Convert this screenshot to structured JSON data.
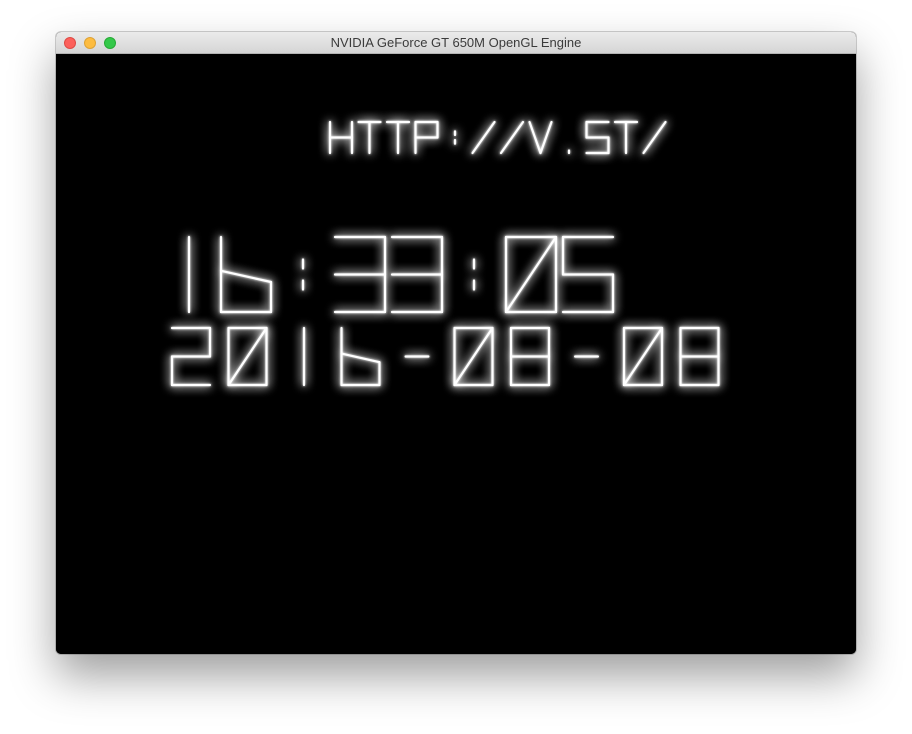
{
  "window": {
    "title": "NVIDIA GeForce GT 650M OpenGL Engine"
  },
  "display": {
    "url": "HTTP://V.ST/",
    "time": "16:33:05",
    "date": "2016-08-08"
  },
  "colors": {
    "background": "#000000",
    "stroke": "#ffffff"
  }
}
